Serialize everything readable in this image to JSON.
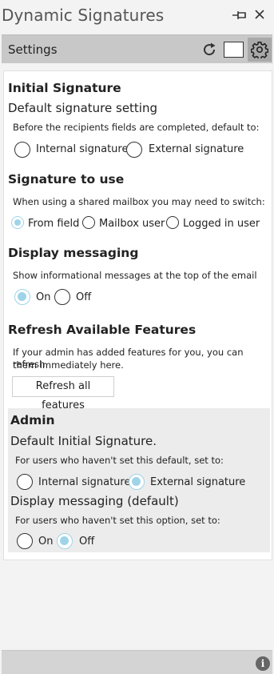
{
  "window": {
    "title": "Dynamic Signatures"
  },
  "toolbar": {
    "label": "Settings"
  },
  "initial_signature": {
    "heading": "Initial Signature",
    "subheading": "Default signature setting",
    "description": "Before the recipients fields are completed, default to:",
    "options": [
      {
        "label": "Internal signature",
        "selected": false
      },
      {
        "label": "External signature",
        "selected": false
      }
    ]
  },
  "signature_to_use": {
    "heading": "Signature to use",
    "description": "When using a shared mailbox you may need to switch:",
    "options": [
      {
        "label": "From field",
        "selected": true
      },
      {
        "label": "Mailbox user",
        "selected": false
      },
      {
        "label": "Logged in user",
        "selected": false
      }
    ]
  },
  "display_messaging": {
    "heading": "Display messaging",
    "description": "Show informational messages at the top of the email",
    "options": [
      {
        "label": "On",
        "selected": true
      },
      {
        "label": "Off",
        "selected": false
      }
    ]
  },
  "refresh_features": {
    "heading": "Refresh Available Features",
    "description_line1": "If your admin has added features for you, you can refresh",
    "description_line2": "them immediately here.",
    "button_label": "Refresh all features"
  },
  "admin": {
    "heading": "Admin",
    "initial_signature": {
      "subheading": "Default Initial Signature.",
      "description": "For users who haven't set this default, set to:",
      "options": [
        {
          "label": "Internal signature",
          "selected": false
        },
        {
          "label": "External signature",
          "selected": true
        }
      ]
    },
    "display_messaging": {
      "subheading": "Display messaging (default)",
      "description": "For users who haven't set this option, set to:",
      "options": [
        {
          "label": "On",
          "selected": false
        },
        {
          "label": "Off",
          "selected": true
        }
      ]
    }
  },
  "icons": {
    "pin": "pin-icon",
    "close": "close-icon",
    "refresh": "refresh-icon",
    "square": "square-icon",
    "gear": "gear-icon",
    "info": "info-icon"
  },
  "colors": {
    "accent_selected": "#9fd4e8",
    "toolbar_bg": "#c8c8c8",
    "admin_bg": "#ececec"
  }
}
